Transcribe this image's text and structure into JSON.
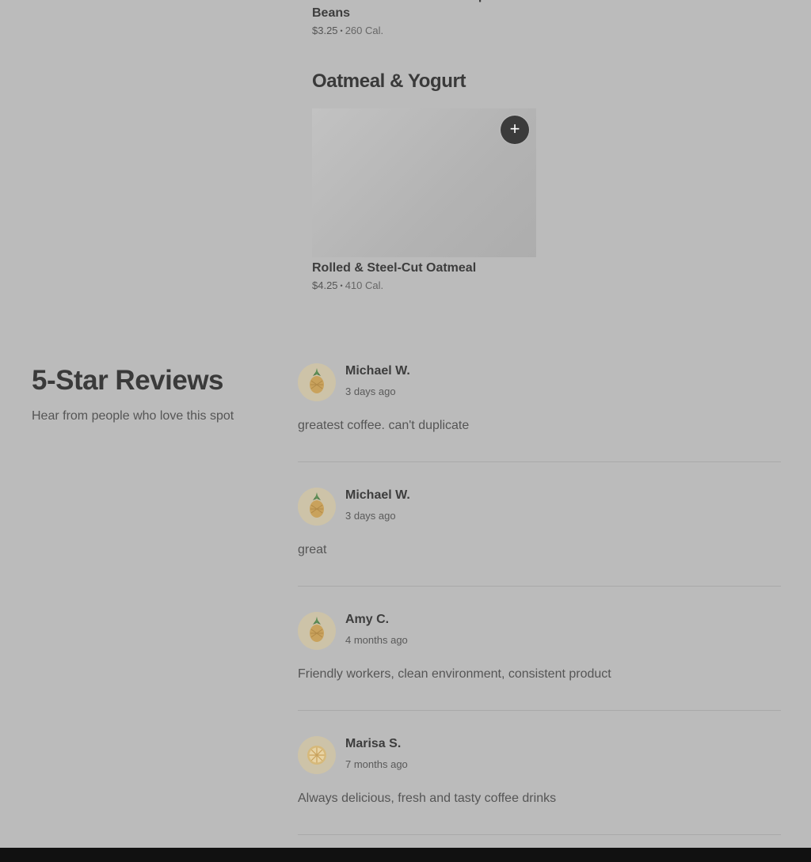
{
  "menu": {
    "top_item": {
      "title": "Dark Chocolate Covered Espresso Beans",
      "price": "$3.25",
      "calories": "260 Cal."
    },
    "sections": [
      {
        "title": "Oatmeal & Yogurt",
        "items": [
          {
            "title": "Rolled & Steel-Cut Oatmeal",
            "price": "$4.25",
            "calories": "410 Cal.",
            "add_label": "+"
          }
        ]
      }
    ],
    "separator": "•"
  },
  "reviews": {
    "title": "5-Star Reviews",
    "subtitle": "Hear from people who love this spot",
    "items": [
      {
        "name": "Michael W.",
        "when": "3 days ago",
        "text": "greatest coffee. can't duplicate",
        "avatar_icon": "pineapple-icon"
      },
      {
        "name": "Michael W.",
        "when": "3 days ago",
        "text": "great",
        "avatar_icon": "pineapple-icon"
      },
      {
        "name": "Amy C.",
        "when": "4 months ago",
        "text": "Friendly workers, clean environment, consistent product",
        "avatar_icon": "pineapple-icon"
      },
      {
        "name": "Marisa S.",
        "when": "7 months ago",
        "text": "Always delicious, fresh and tasty coffee drinks",
        "avatar_icon": "citrus-slice-icon"
      }
    ]
  },
  "colors": {
    "overlay_background": "#bbbbbb",
    "avatar_background": "#cdc3a8",
    "footer": "#111111"
  }
}
